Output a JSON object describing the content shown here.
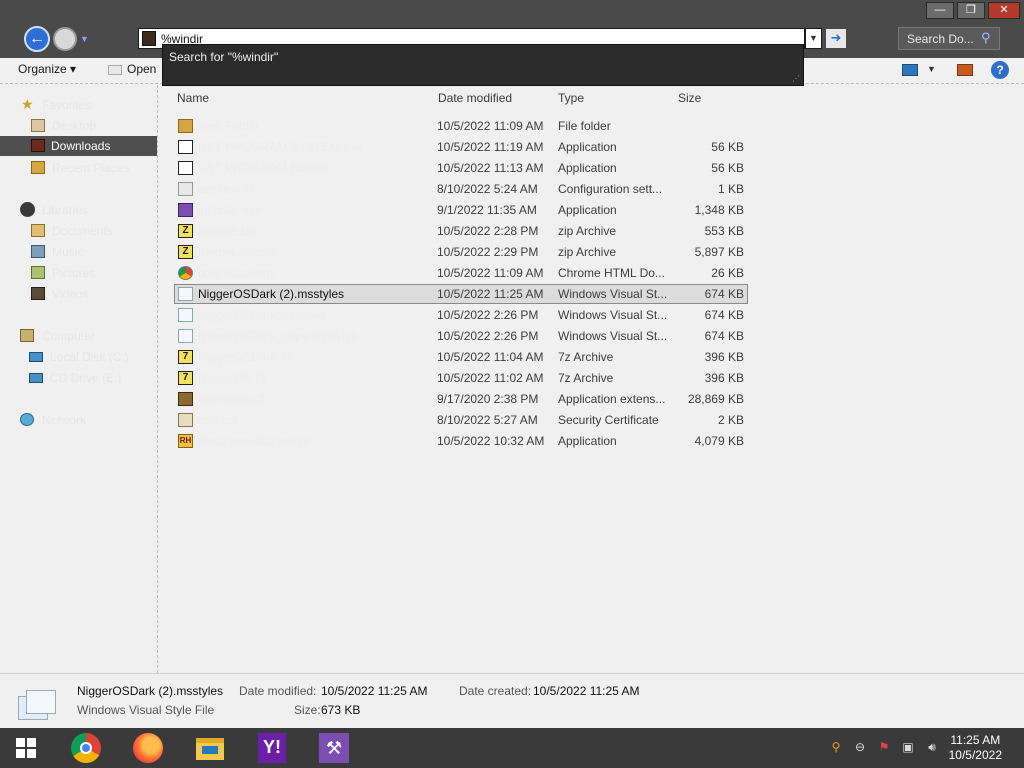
{
  "window": {
    "min": "0",
    "max": "1",
    "close": "r"
  },
  "nav": {
    "address_value": "%windir",
    "search_placeholder": "Search Do..."
  },
  "suggest": {
    "item": "Search for \"%windir\""
  },
  "toolbar": {
    "organize": "Organize ▾",
    "open": "Open"
  },
  "sidebar": {
    "items": [
      {
        "label": "Favorites",
        "icon": "star-icon"
      },
      {
        "label": "Desktop",
        "icon": "desktop-icon"
      },
      {
        "label": "Downloads",
        "icon": "downloads-icon"
      },
      {
        "label": "Recent Places",
        "icon": "recent-places-icon"
      },
      {
        "label": "Libraries",
        "icon": "libraries-icon"
      },
      {
        "label": "Documents",
        "icon": "documents-icon"
      },
      {
        "label": "Music",
        "icon": "music-icon"
      },
      {
        "label": "Pictures",
        "icon": "pictures-icon"
      },
      {
        "label": "Videos",
        "icon": "videos-icon"
      },
      {
        "label": "Computer",
        "icon": "computer-icon"
      },
      {
        "label": "Local Disk (C:)",
        "icon": "drive-icon"
      },
      {
        "label": "CD Drive (E:)",
        "icon": "cd-drive-icon"
      },
      {
        "label": "Network",
        "icon": "network-icon"
      }
    ]
  },
  "columns": {
    "name": "Name",
    "date": "Date modified",
    "type": "Type",
    "size": "Size"
  },
  "files": [
    {
      "name": "New Folder",
      "date": "10/5/2022 11:09 AM",
      "type": "File folder",
      "size": "",
      "icon": "folder-icon"
    },
    {
      "name": "UST PROGRAM SYSTEM.exe",
      "date": "10/5/2022 11:19 AM",
      "type": "Application",
      "size": "56 KB",
      "icon": "app-icon"
    },
    {
      "name": "UST PROGRAM Edition",
      "date": "10/5/2022 11:13 AM",
      "type": "Application",
      "size": "56 KB",
      "icon": "app-icon"
    },
    {
      "name": "desktop.ini",
      "date": "8/10/2022 5:24 AM",
      "type": "Configuration sett...",
      "size": "1 KB",
      "icon": "config-icon"
    },
    {
      "name": "installer.exe",
      "date": "9/1/2022 11:35 AM",
      "type": "Application",
      "size": "1,348 KB",
      "icon": "vs-app-icon"
    },
    {
      "name": "archive.zip",
      "date": "10/5/2022 2:28 PM",
      "type": "zip Archive",
      "size": "553 KB",
      "icon": "zip-icon"
    },
    {
      "name": "themepack.zip",
      "date": "10/5/2022 2:29 PM",
      "type": "zip Archive",
      "size": "5,897 KB",
      "icon": "zip-icon"
    },
    {
      "name": "download.html",
      "date": "10/5/2022 11:09 AM",
      "type": "Chrome HTML Do...",
      "size": "26 KB",
      "icon": "chrome-icon"
    },
    {
      "name": "NiggerOSDark (2).msstyles",
      "date": "10/5/2022 11:25 AM",
      "type": "Windows Visual St...",
      "size": "674 KB",
      "icon": "msstyles-icon",
      "selected": true
    },
    {
      "name": "NiggerOSDark.msstyles",
      "date": "10/5/2022 2:26 PM",
      "type": "Windows Visual St...",
      "size": "674 KB",
      "icon": "msstyles-icon"
    },
    {
      "name": "NiggerOSDark_copy.msstyles",
      "date": "10/5/2022 2:26 PM",
      "type": "Windows Visual St...",
      "size": "674 KB",
      "icon": "msstyles-icon"
    },
    {
      "name": "NiggerOSDark.7z",
      "date": "10/5/2022 11:04 AM",
      "type": "7z Archive",
      "size": "396 KB",
      "icon": "7z-icon"
    },
    {
      "name": "NiggerOS.7z",
      "date": "10/5/2022 11:02 AM",
      "type": "7z Archive",
      "size": "396 KB",
      "icon": "7z-icon"
    },
    {
      "name": "extension.dll",
      "date": "9/17/2020 2:38 PM",
      "type": "Application extens...",
      "size": "28,869 KB",
      "icon": "dll-icon"
    },
    {
      "name": "cert.cer",
      "date": "8/10/2022 5:27 AM",
      "type": "Security Certificate",
      "size": "2 KB",
      "icon": "certificate-icon"
    },
    {
      "name": "ResourceHacker.exe",
      "date": "10/5/2022 10:32 AM",
      "type": "Application",
      "size": "4,079 KB",
      "icon": "rh-icon"
    }
  ],
  "details": {
    "name": "NiggerOSDark (2).msstyles",
    "type": "Windows Visual Style File",
    "date_modified_label": "Date modified:",
    "date_modified": "10/5/2022 11:25 AM",
    "date_created_label": "Date created:",
    "date_created": "10/5/2022 11:25 AM",
    "size_label": "Size:",
    "size": "673 KB"
  },
  "taskbar": {
    "time": "11:25 AM",
    "date": "10/5/2022"
  }
}
